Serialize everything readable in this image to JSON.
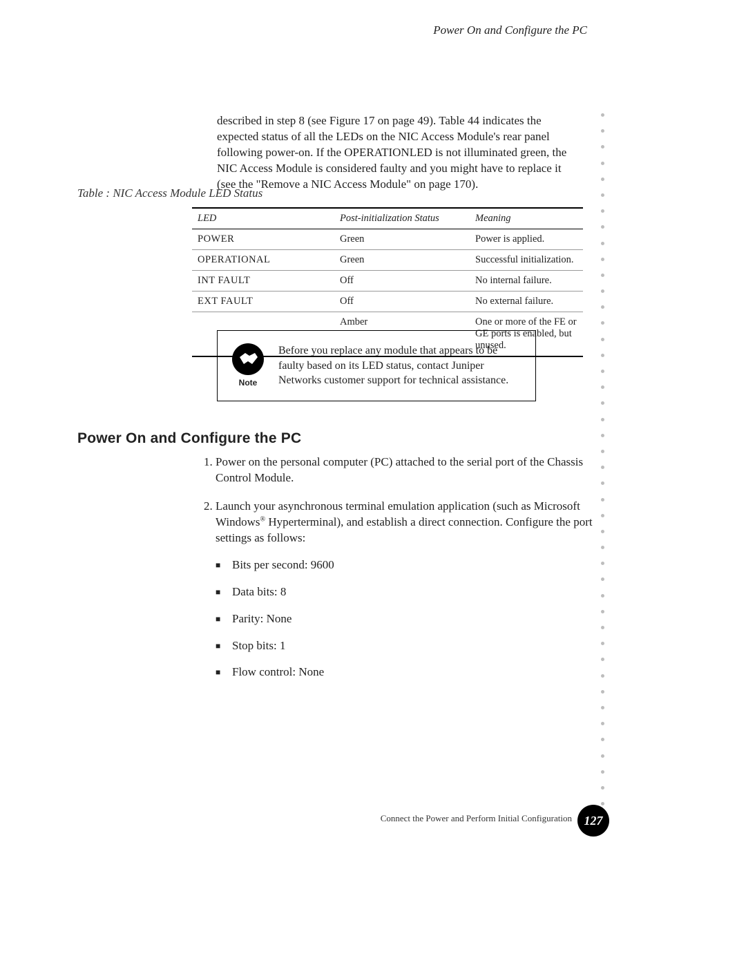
{
  "running_head": "Power On and Configure the PC",
  "intro_paragraph": "described in step 8 (see Figure 17 on page 49). Table 44 indicates the expected status of all the LEDs on the NIC Access Module's rear panel following power-on. If the OPERATIONLED is not illuminated green, the NIC Access Module is considered faulty and you might have to replace it (see the \"Remove a NIC Access Module\" on page 170).",
  "table_caption": "Table   :   NIC Access Module LED Status",
  "table": {
    "headers": {
      "led": "LED",
      "status": "Post-initialization Status",
      "meaning": "Meaning"
    },
    "rows": [
      {
        "led": "POWER",
        "status": "Green",
        "meaning": "Power is applied."
      },
      {
        "led": "OPERATIONAL",
        "status": "Green",
        "meaning": "Successful initialization."
      },
      {
        "led": "INT FAULT",
        "status": "Off",
        "meaning": "No internal failure."
      },
      {
        "led": "EXT FAULT",
        "status": "Off",
        "meaning": "No external failure."
      },
      {
        "led": "",
        "status": "Amber",
        "meaning": "One or more of the FE or GE ports is enabled, but unused."
      }
    ]
  },
  "note": {
    "label": "Note",
    "text": "Before you replace any module that appears to be faulty based on its LED status, contact Juniper Networks customer support for technical assistance."
  },
  "section_heading": "Power On and Configure the PC",
  "steps": {
    "s1": "Power on the personal computer (PC) attached to the serial port of the Chassis Control Module.",
    "s2_a": "Launch your asynchronous terminal emulation application (such as Microsoft Windows",
    "s2_b": " Hyperterminal), and establish a direct connection. Configure the port settings as follows:",
    "bullets": {
      "b1": "Bits per second: 9600",
      "b2": "Data bits: 8",
      "b3": "Parity: None",
      "b4": "Stop bits: 1",
      "b5": "Flow control: None"
    }
  },
  "footer": {
    "chapter": "Connect the Power and Perform Initial Configuration",
    "page": "127"
  }
}
